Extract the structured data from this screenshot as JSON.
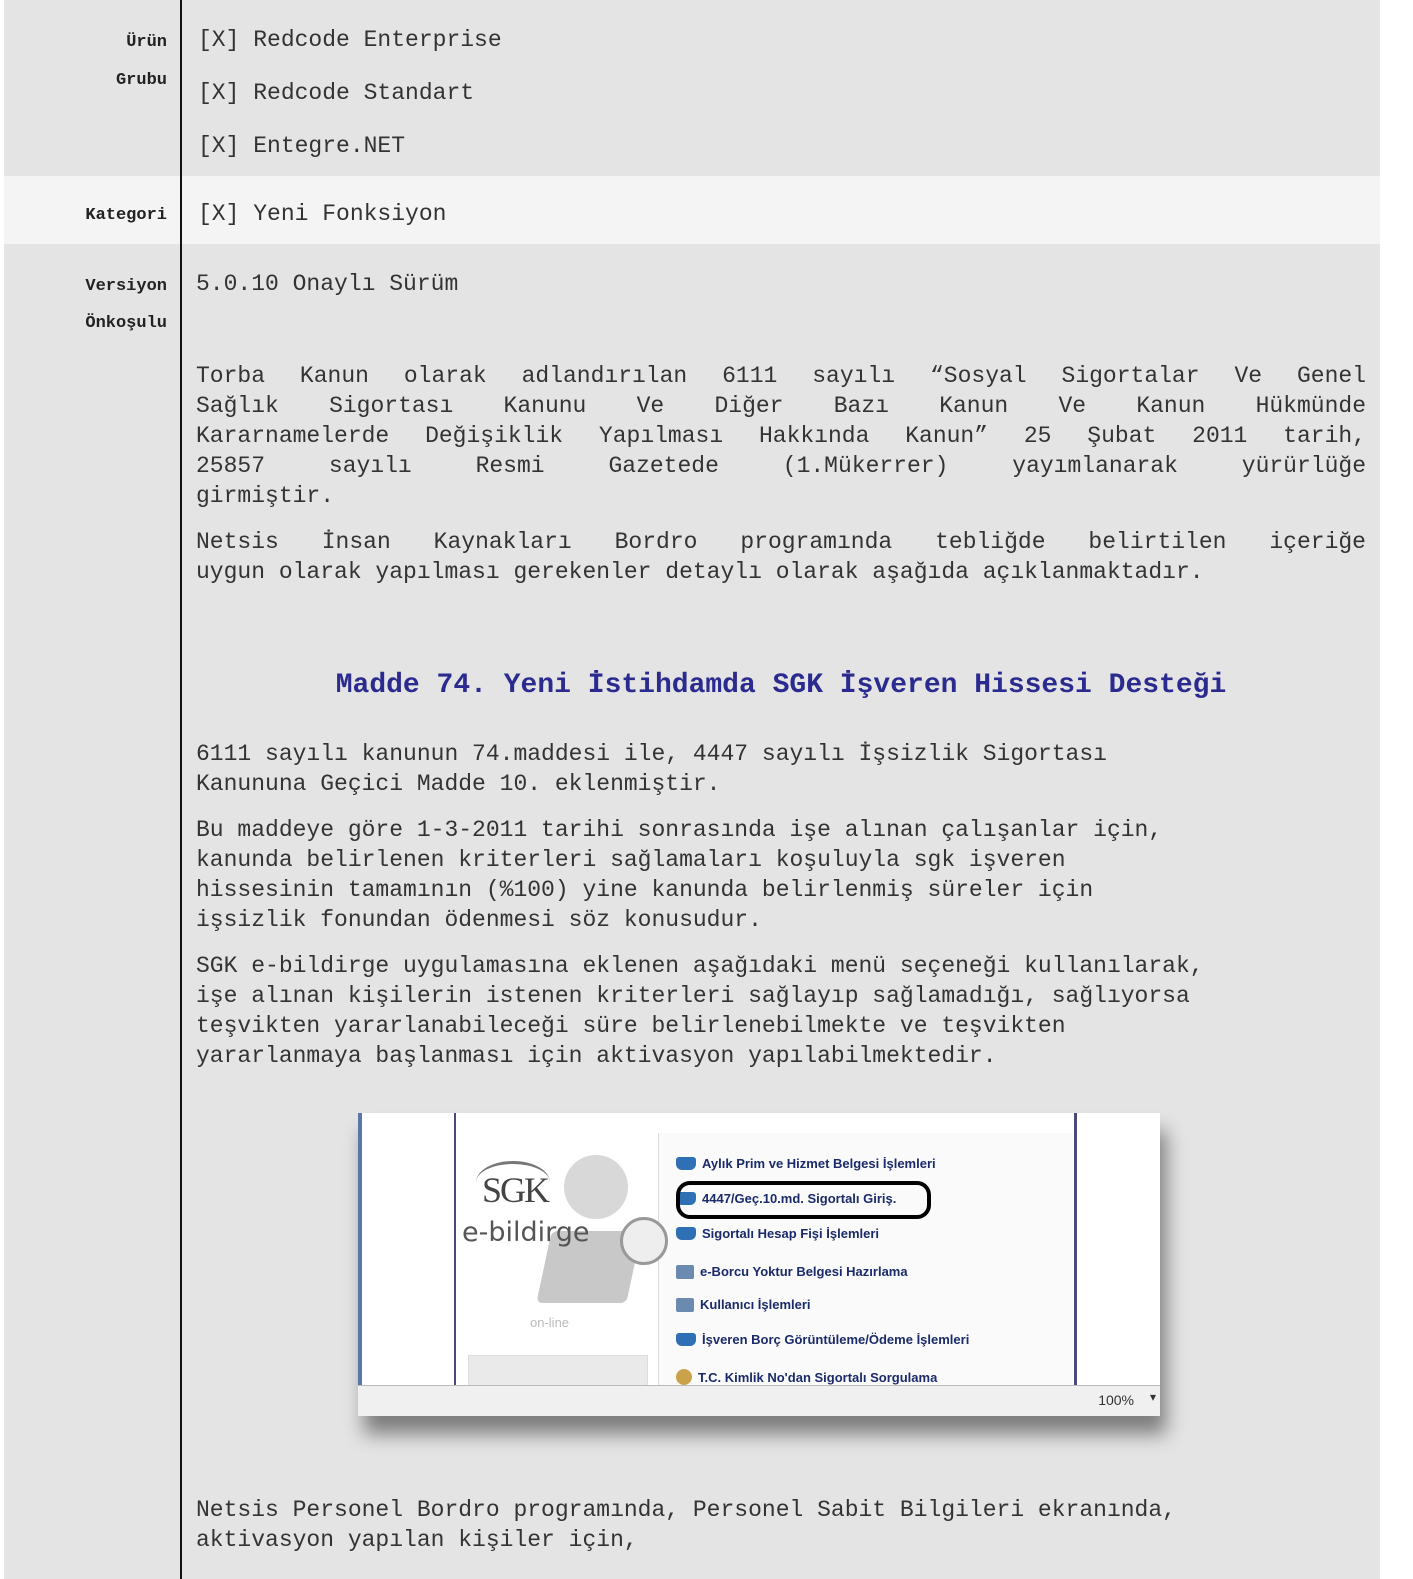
{
  "fields": {
    "urun_grubu": {
      "label_line1": "Ürün",
      "label_line2": "Grubu",
      "items": [
        "[X] Redcode Enterprise",
        "[X] Redcode Standart",
        "[X] Entegre.NET"
      ]
    },
    "kategori": {
      "label": "Kategori",
      "value": "[X] Yeni Fonksiyon"
    },
    "versiyon": {
      "label_line1": "Versiyon",
      "label_line2": "Önkoşulu",
      "value": "5.0.10 Onaylı Sürüm"
    }
  },
  "body": {
    "intro_lines": [
      "Torba Kanun olarak adlandırılan 6111 sayılı “Sosyal Sigortalar Ve Genel",
      "Sağlık Sigortası Kanunu Ve Diğer Bazı Kanun Ve Kanun Hükmünde",
      "Kararnamelerde Değişiklik Yapılması Hakkında Kanun” 25 Şubat 2011 tarih,",
      "25857 sayılı Resmi Gazetede (1.Mükerrer) yayımlanarak yürürlüğe",
      "girmiştir."
    ],
    "intro2_lines": [
      "Netsis İnsan Kaynakları Bordro programında tebliğde belirtilen içeriğe",
      "uygun olarak yapılması gerekenler detaylı olarak aşağıda açıklanmaktadır."
    ],
    "heading": "Madde 74. Yeni İstihdamda SGK İşveren Hissesi Desteği",
    "p1_lines": [
      "6111 sayılı kanunun 74.maddesi ile, 4447 sayılı İşsizlik Sigortası",
      "Kanununa Geçici Madde 10. eklenmiştir."
    ],
    "p2_lines": [
      "Bu maddeye göre 1-3-2011 tarihi sonrasında işe alınan çalışanlar için,",
      "kanunda belirlenen kriterleri sağlamaları koşuluyla sgk işveren",
      "hissesinin tamamının (%100) yine kanunda belirlenmiş süreler için",
      "işsizlik fonundan ödenmesi söz konusudur."
    ],
    "p3_lines": [
      "SGK e-bildirge uygulamasına eklenen aşağıdaki menü seçeneği kullanılarak,",
      "işe alınan kişilerin istenen kriterleri sağlayıp sağlamadığı, sağlıyorsa",
      "teşvikten yararlanabileceği süre belirlenebilmekte ve teşvikten",
      "yararlanmaya başlanması için aktivasyon yapılabilmektedir."
    ],
    "p4_lines": [
      "Netsis Personel Bordro programında, Personel Sabit Bilgileri ekranında,",
      "aktivasyon yapılan kişiler için,"
    ]
  },
  "figure": {
    "logo_text": "SGK",
    "app_name": "e-bildirge",
    "online_text": "on-line",
    "zoom": "100%",
    "menu_items": [
      {
        "label": "Aylık Prim ve Hizmet Belgesi İşlemleri",
        "icon": "folder-icon"
      },
      {
        "label": "4447/Geç.10.md. Sigortalı Giriş.",
        "icon": "folder-icon",
        "highlighted": true
      },
      {
        "label": "Sigortalı Hesap Fişi İşlemleri",
        "icon": "folder-icon"
      },
      {
        "label": "e-Borcu Yoktur Belgesi Hazırlama",
        "icon": "document-icon"
      },
      {
        "label": "Kullanıcı İşlemleri",
        "icon": "users-icon"
      },
      {
        "label": "İşveren Borç Görüntüleme/Ödeme İşlemleri",
        "icon": "folder-icon"
      },
      {
        "label": "T.C. Kimlik No'dan Sigortalı Sorgulama",
        "icon": "person-icon"
      }
    ]
  }
}
